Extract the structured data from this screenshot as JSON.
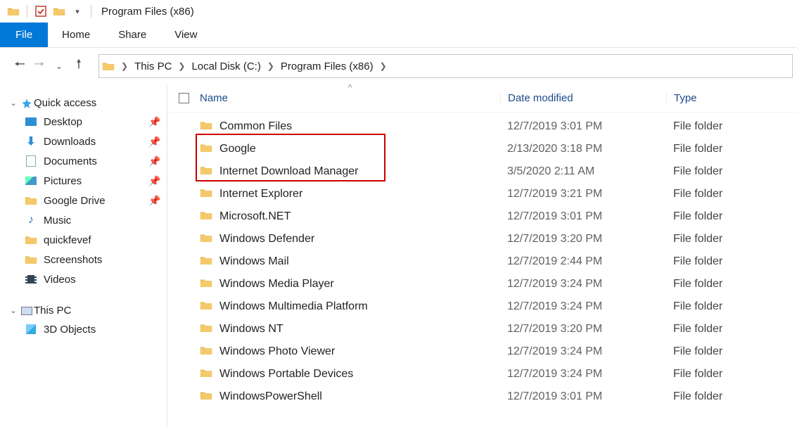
{
  "title": "Program Files (x86)",
  "ribbon": {
    "file": "File",
    "home": "Home",
    "share": "Share",
    "view": "View"
  },
  "breadcrumb": [
    "This PC",
    "Local Disk (C:)",
    "Program Files (x86)"
  ],
  "nav": {
    "quick_access": {
      "label": "Quick access",
      "items": [
        {
          "label": "Desktop",
          "pinned": true,
          "icon": "desktop"
        },
        {
          "label": "Downloads",
          "pinned": true,
          "icon": "downloads"
        },
        {
          "label": "Documents",
          "pinned": true,
          "icon": "documents"
        },
        {
          "label": "Pictures",
          "pinned": true,
          "icon": "pictures"
        },
        {
          "label": "Google Drive",
          "pinned": true,
          "icon": "folder"
        },
        {
          "label": "Music",
          "pinned": false,
          "icon": "music"
        },
        {
          "label": "quickfevef",
          "pinned": false,
          "icon": "folder"
        },
        {
          "label": "Screenshots",
          "pinned": false,
          "icon": "folder"
        },
        {
          "label": "Videos",
          "pinned": false,
          "icon": "videos"
        }
      ]
    },
    "this_pc": {
      "label": "This PC",
      "items": [
        {
          "label": "3D Objects",
          "icon": "3d"
        }
      ]
    }
  },
  "columns": {
    "name": "Name",
    "date": "Date modified",
    "type": "Type"
  },
  "rows": [
    {
      "name": "Common Files",
      "date": "12/7/2019 3:01 PM",
      "type": "File folder"
    },
    {
      "name": "Google",
      "date": "2/13/2020 3:18 PM",
      "type": "File folder"
    },
    {
      "name": "Internet Download Manager",
      "date": "3/5/2020 2:11 AM",
      "type": "File folder"
    },
    {
      "name": "Internet Explorer",
      "date": "12/7/2019 3:21 PM",
      "type": "File folder"
    },
    {
      "name": "Microsoft.NET",
      "date": "12/7/2019 3:01 PM",
      "type": "File folder"
    },
    {
      "name": "Windows Defender",
      "date": "12/7/2019 3:20 PM",
      "type": "File folder"
    },
    {
      "name": "Windows Mail",
      "date": "12/7/2019 2:44 PM",
      "type": "File folder"
    },
    {
      "name": "Windows Media Player",
      "date": "12/7/2019 3:24 PM",
      "type": "File folder"
    },
    {
      "name": "Windows Multimedia Platform",
      "date": "12/7/2019 3:24 PM",
      "type": "File folder"
    },
    {
      "name": "Windows NT",
      "date": "12/7/2019 3:20 PM",
      "type": "File folder"
    },
    {
      "name": "Windows Photo Viewer",
      "date": "12/7/2019 3:24 PM",
      "type": "File folder"
    },
    {
      "name": "Windows Portable Devices",
      "date": "12/7/2019 3:24 PM",
      "type": "File folder"
    },
    {
      "name": "WindowsPowerShell",
      "date": "12/7/2019 3:01 PM",
      "type": "File folder"
    }
  ],
  "highlight_rows": [
    1,
    2
  ]
}
